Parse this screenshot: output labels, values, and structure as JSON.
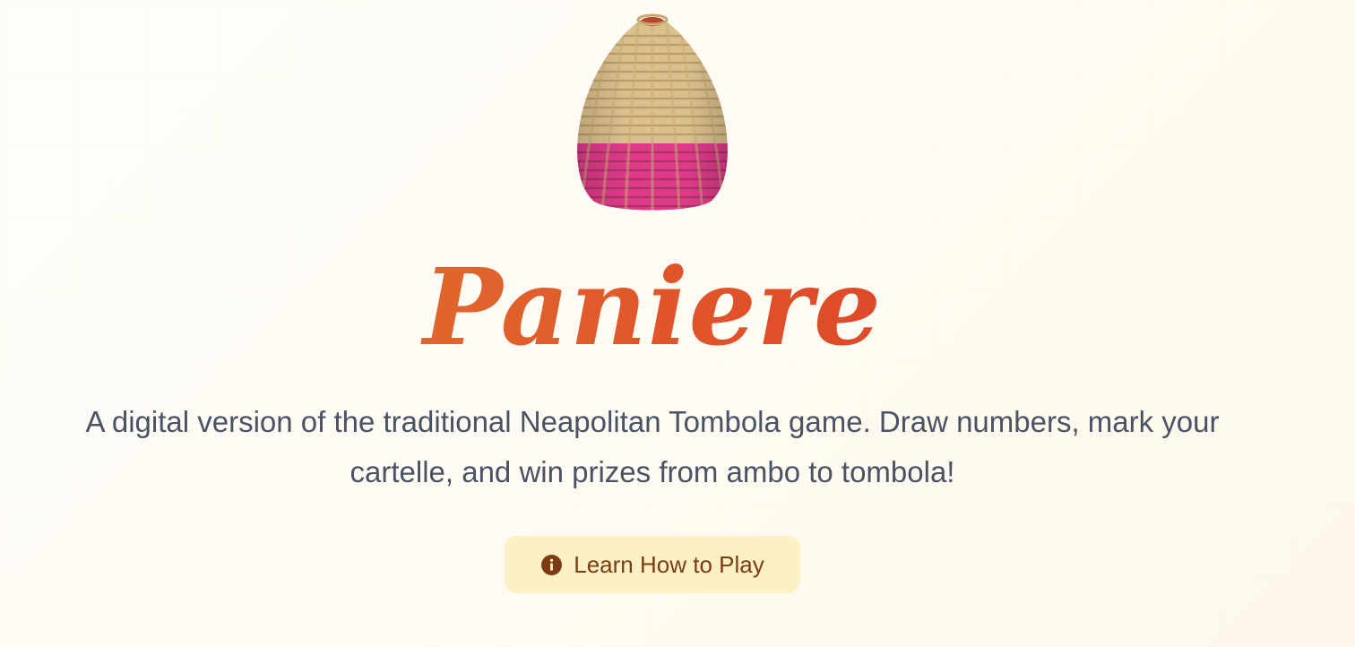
{
  "hero": {
    "image": "wicker-basket-illustration",
    "title": "Paniere",
    "description": "A digital version of the traditional Neapolitan Tombola game. Draw numbers, mark your cartelle, and win prizes from ambo to tombola!"
  },
  "actions": {
    "learn_button": {
      "label": "Learn How to Play",
      "icon": "info-circle-icon"
    }
  },
  "colors": {
    "title_gradient_start": "#e08332",
    "title_gradient_end": "#d9302a",
    "body_text": "#4a5263",
    "button_bg": "#fdf0c4",
    "button_text": "#7c3b12",
    "page_bg": "#fefcf4"
  }
}
